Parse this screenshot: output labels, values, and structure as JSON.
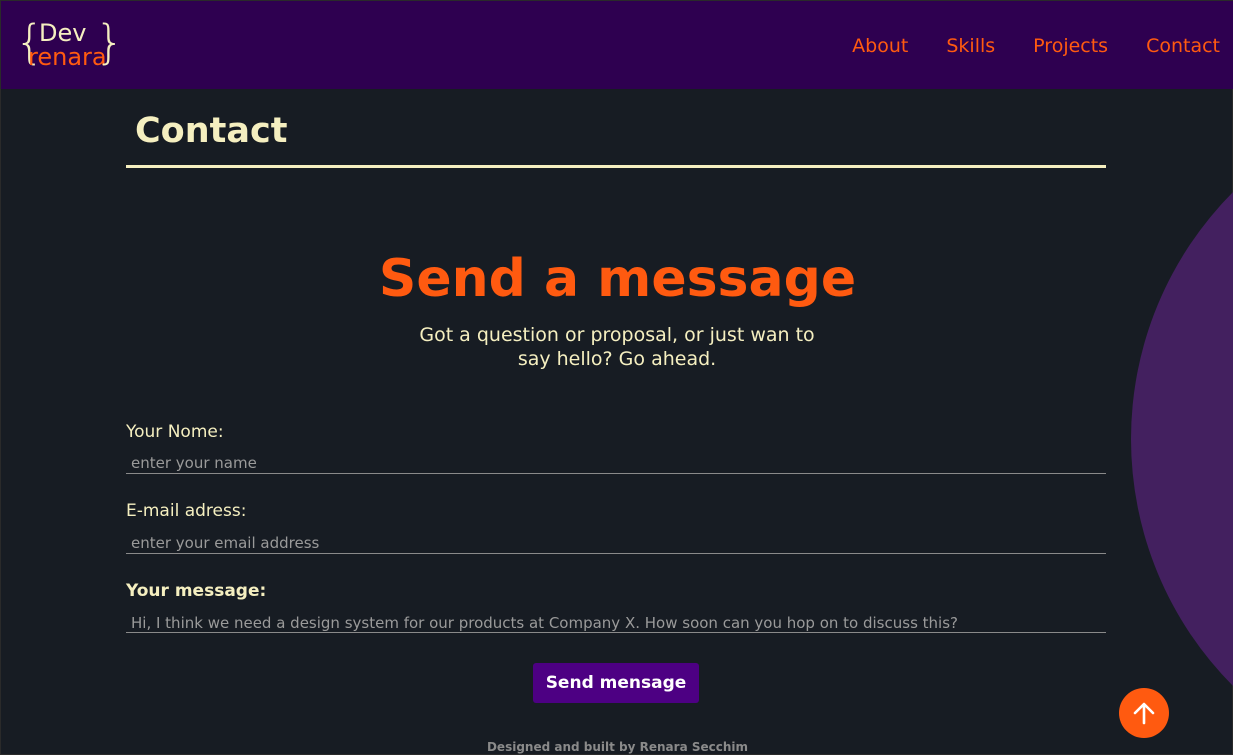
{
  "header": {
    "logo": {
      "dev": "Dev",
      "renara": "renara",
      "brace_left": "{",
      "brace_right": "}"
    },
    "nav": [
      "About",
      "Skills",
      "Projects",
      "Contact"
    ]
  },
  "section": {
    "title": "Contact"
  },
  "hero": {
    "title": "Send a message",
    "subtitle": "Got a question or proposal, or just wan to say hello? Go ahead."
  },
  "form": {
    "name": {
      "label": "Your Nome:",
      "placeholder": "enter your name"
    },
    "email": {
      "label": "E-mail adress:",
      "placeholder": "enter your email address"
    },
    "message": {
      "label": "Your message:",
      "placeholder": "Hi, I think we need a design system for our products at Company X. How soon can you hop on to discuss this?"
    },
    "submit": "Send mensage"
  },
  "footer": {
    "credit": "Designed and built by Renara Secchim"
  },
  "colors": {
    "accent": "#ff5a10",
    "cream": "#f5efc0",
    "header_bg": "#2e0050",
    "button_bg": "#4d0083",
    "arc": "#43205f"
  },
  "icons": {
    "to_top": "arrow-up-icon"
  }
}
